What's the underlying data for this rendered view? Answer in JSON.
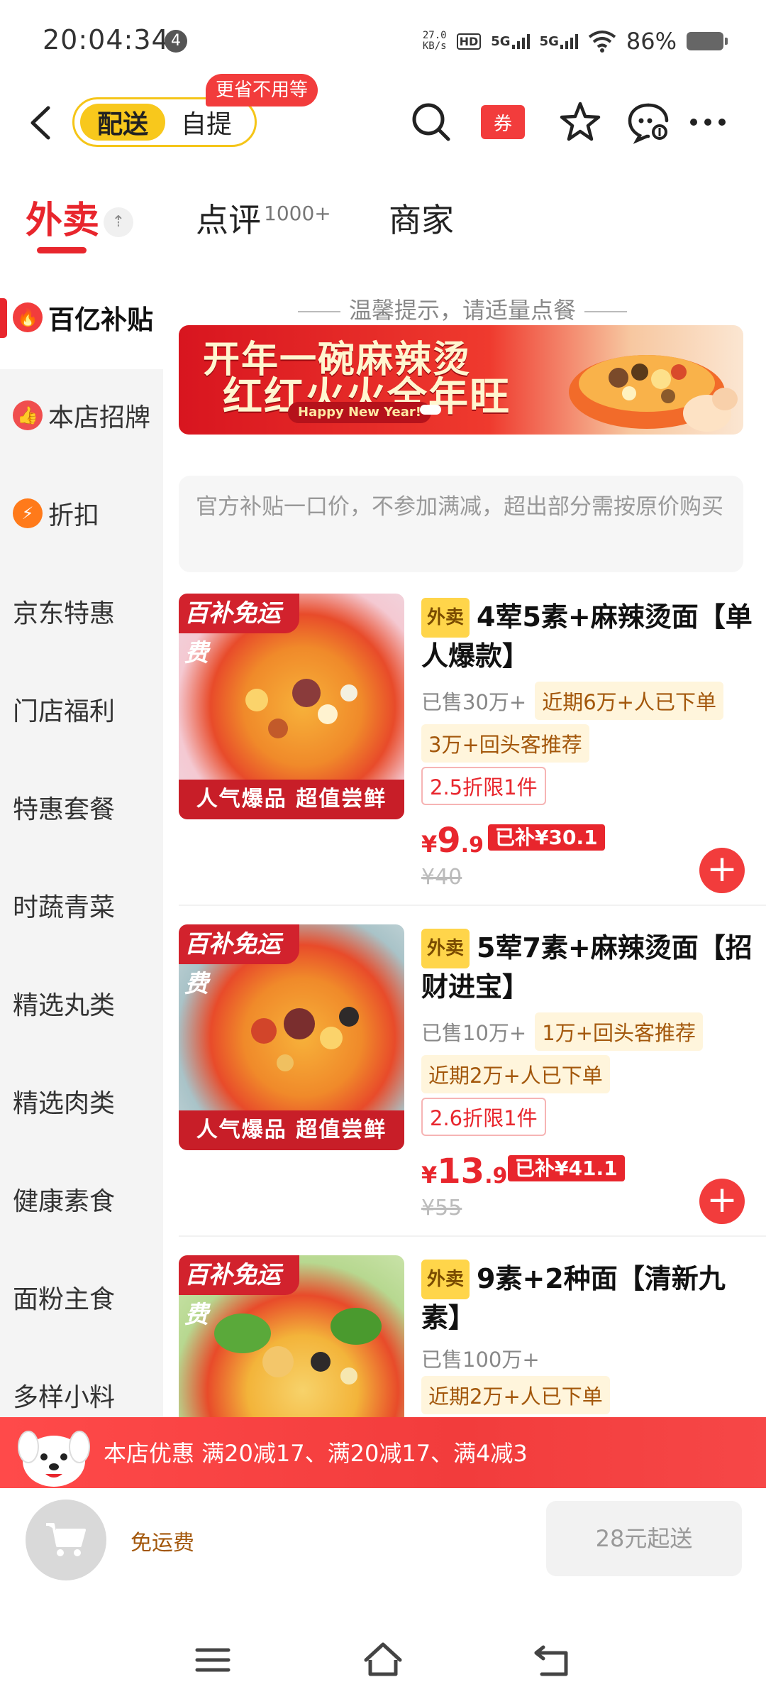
{
  "status_bar": {
    "time": "20:04:34",
    "notification_count": "4",
    "net_speed_value": "27.0",
    "net_speed_unit": "KB/s",
    "hd_label": "HD",
    "sim1": "5G",
    "sim2": "5G",
    "battery": "86%"
  },
  "header": {
    "mode_active": "配送",
    "mode_inactive": "自提",
    "promo_bubble": "更省不用等",
    "coupon_label": "券"
  },
  "tabs": [
    {
      "label": "外卖"
    },
    {
      "label": "点评",
      "count": "1000+"
    },
    {
      "label": "商家"
    }
  ],
  "sidebar": {
    "items": [
      {
        "label": "百亿补贴"
      },
      {
        "label": "本店招牌"
      },
      {
        "label": "折扣"
      },
      {
        "label": "京东特惠"
      },
      {
        "label": "门店福利"
      },
      {
        "label": "特惠套餐"
      },
      {
        "label": "时蔬青菜"
      },
      {
        "label": "精选丸类"
      },
      {
        "label": "精选肉类"
      },
      {
        "label": "健康素食"
      },
      {
        "label": "面粉主食"
      },
      {
        "label": "多样小料"
      }
    ]
  },
  "content": {
    "tip": "温馨提示，请适量点餐",
    "banner": {
      "line1": "开年一碗麻辣烫",
      "line2": "红红火火全年旺",
      "pill": "Happy New Year!"
    },
    "notice": "官方补贴一口价，不参加满减，超出部分需按原价购买"
  },
  "products": [
    {
      "img_top": "百补免运费",
      "img_bottom": "人气爆品 超值尝鲜",
      "tag": "外卖",
      "title": "4荤5素+麻辣烫面【单人爆款】",
      "sold": "已售30万+",
      "pill_a": "近期6万+人已下单",
      "pill_b": "3万+回头客推荐",
      "discount": "2.5折限1件",
      "price_cur": "¥",
      "price_int": "9",
      "price_dec": ".9",
      "subsidy": "已补¥30.1",
      "orig": "¥40"
    },
    {
      "img_top": "百补免运费",
      "img_bottom": "人气爆品 超值尝鲜",
      "tag": "外卖",
      "title": "5荤7素+麻辣烫面【招财进宝】",
      "sold": "已售10万+",
      "pill_a": "1万+回头客推荐",
      "pill_b": "近期2万+人已下单",
      "discount": "2.6折限1件",
      "price_cur": "¥",
      "price_int": "13",
      "price_dec": ".9",
      "subsidy": "已补¥41.1",
      "orig": "¥55"
    },
    {
      "img_top": "百补免运费",
      "tag": "外卖",
      "title": "9素+2种面【清新九素】",
      "sold": "已售100万+",
      "pill_a": "近期2万+人已下单"
    }
  ],
  "promo_bar": {
    "text": "本店优惠  满20减17、满20减17、满4减3"
  },
  "cart": {
    "free_shipping": "免运费",
    "min_order": "28元起送"
  },
  "colors": {
    "accent_red": "#e8262d",
    "accent_yellow": "#f8c81c"
  }
}
